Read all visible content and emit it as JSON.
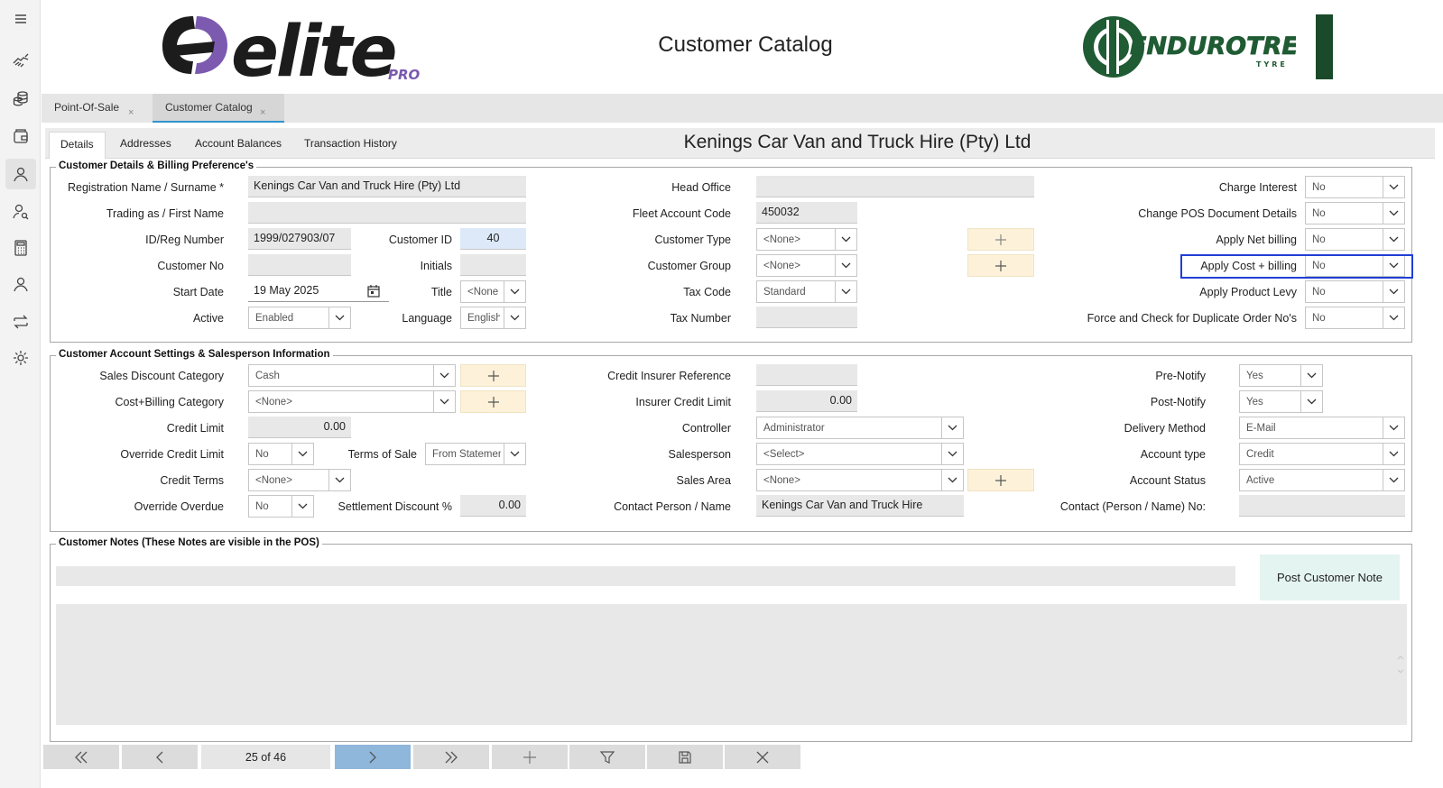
{
  "app": {
    "page_title": "Customer Catalog",
    "brand_logo": "elite PRO",
    "partner_logo": "ENDUROTREAD TYRE",
    "accent_color": "#2f93cf",
    "highlight_color": "#1f3fd6"
  },
  "sidebar": {
    "icons": [
      "menu-icon",
      "handshake-icon",
      "coins-icon",
      "wallet-icon",
      "customer-icon",
      "user-search-icon",
      "calculator-icon",
      "person-icon",
      "transfer-icon",
      "settings-icon"
    ]
  },
  "doc_tabs": [
    {
      "label": "Point-Of-Sale",
      "close": "×"
    },
    {
      "label": "Customer Catalog",
      "close": "×"
    }
  ],
  "sub_tabs": [
    "Details",
    "Addresses",
    "Account Balances",
    "Transaction History"
  ],
  "customer_heading": "Kenings Car Van and Truck Hire (Pty) Ltd",
  "billing": {
    "title": "Customer Details & Billing Preference's",
    "registration_name_label": "Registration Name / Surname *",
    "registration_name": "Kenings Car Van and Truck Hire (Pty) Ltd",
    "trading_as_label": "Trading as / First Name",
    "trading_as": "",
    "id_reg_label": "ID/Reg Number",
    "id_reg": "1999/027903/07",
    "customer_id_label": "Customer ID",
    "customer_id": "40",
    "customer_no_label": "Customer No",
    "customer_no": "",
    "initials_label": "Initials",
    "initials": "",
    "start_date_label": "Start Date",
    "start_date": "19 May 2025",
    "title_label": "Title",
    "title_value": "<None",
    "active_label": "Active",
    "active_value": "Enabled",
    "language_label": "Language",
    "language_value": "English",
    "head_office_label": "Head Office",
    "head_office": "",
    "fleet_label": "Fleet Account Code",
    "fleet": "450032",
    "customer_type_label": "Customer Type",
    "customer_type": "<None>",
    "customer_group_label": "Customer Group",
    "customer_group": "<None>",
    "tax_code_label": "Tax Code",
    "tax_code": "Standard",
    "tax_number_label": "Tax Number",
    "tax_number": "",
    "charge_interest_label": "Charge Interest",
    "charge_interest": "No",
    "change_pos_label": "Change POS Document Details",
    "change_pos": "No",
    "net_billing_label": "Apply Net billing",
    "net_billing": "No",
    "cost_billing_label": "Apply Cost + billing",
    "cost_billing": "No",
    "product_levy_label": "Apply Product Levy",
    "product_levy": "No",
    "dup_order_label": "Force and Check for Duplicate Order No's",
    "dup_order": "No"
  },
  "account": {
    "title": "Customer Account Settings & Salesperson Information",
    "sales_discount_label": "Sales Discount Category",
    "sales_discount": "Cash",
    "cost_billing_cat_label": "Cost+Billing Category",
    "cost_billing_cat": "<None>",
    "credit_limit_label": "Credit Limit",
    "credit_limit": "0.00",
    "override_credit_label": "Override Credit Limit",
    "override_credit": "No",
    "terms_label": "Terms of Sale",
    "terms": "From Statement",
    "credit_terms_label": "Credit Terms",
    "credit_terms": "<None>",
    "override_overdue_label": "Override Overdue",
    "override_overdue": "No",
    "settlement_label": "Settlement Discount %",
    "settlement": "0.00",
    "insurer_ref_label": "Credit Insurer Reference",
    "insurer_ref": "",
    "insurer_limit_label": "Insurer Credit Limit",
    "insurer_limit": "0.00",
    "controller_label": "Controller",
    "controller": "Administrator",
    "salesperson_label": "Salesperson",
    "salesperson": "<Select>",
    "sales_area_label": "Sales Area",
    "sales_area": "<None>",
    "contact_label": "Contact Person / Name",
    "contact": "Kenings Car Van and Truck Hire",
    "pre_notify_label": "Pre-Notify",
    "pre_notify": "Yes",
    "post_notify_label": "Post-Notify",
    "post_notify": "Yes",
    "delivery_label": "Delivery Method",
    "delivery": "E-Mail",
    "account_type_label": "Account type",
    "account_type": "Credit",
    "account_status_label": "Account Status",
    "account_status": "Active",
    "contact_no_label": "Contact (Person / Name) No:",
    "contact_no": ""
  },
  "notes": {
    "title": "Customer Notes (These Notes are visible in the POS)",
    "input_value": "",
    "post_button": "Post Customer Note",
    "body": ""
  },
  "navigation": {
    "record_position": "25 of 46",
    "buttons": [
      "first-icon",
      "previous-icon",
      "next-icon",
      "last-icon",
      "add-icon",
      "filter-icon",
      "save-icon",
      "close-icon"
    ]
  }
}
